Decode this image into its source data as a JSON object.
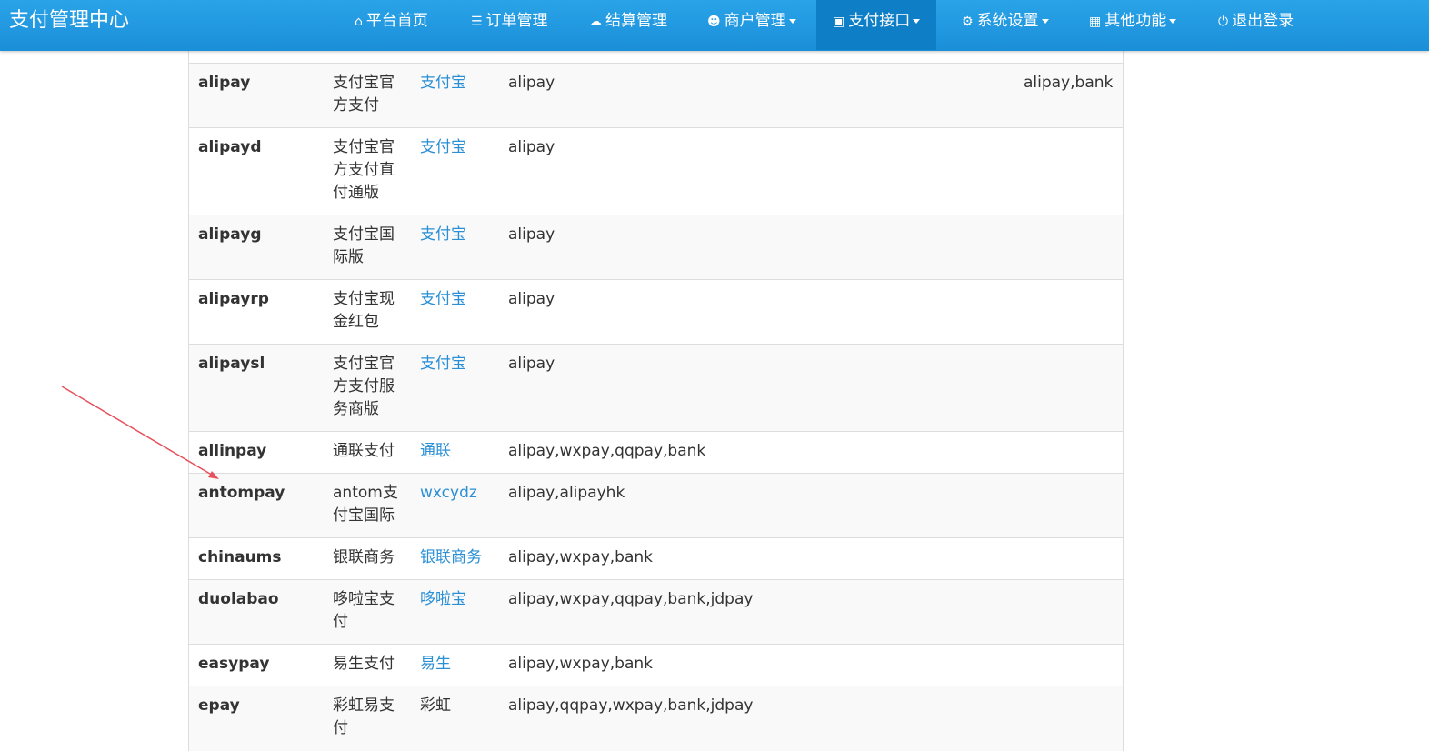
{
  "header": {
    "brand": "支付管理中心",
    "nav": [
      {
        "label": "平台首页",
        "icon": "home-icon",
        "dropdown": false,
        "active": false
      },
      {
        "label": "订单管理",
        "icon": "list-icon",
        "dropdown": false,
        "active": false
      },
      {
        "label": "结算管理",
        "icon": "cloud-icon",
        "dropdown": false,
        "active": false
      },
      {
        "label": "商户管理",
        "icon": "user-icon",
        "dropdown": true,
        "active": false
      },
      {
        "label": "支付接口",
        "icon": "credit-card-icon",
        "dropdown": true,
        "active": true
      },
      {
        "label": "系统设置",
        "icon": "gear-icon",
        "dropdown": true,
        "active": false
      },
      {
        "label": "其他功能",
        "icon": "cube-icon",
        "dropdown": true,
        "active": false
      },
      {
        "label": "退出登录",
        "icon": "power-icon",
        "dropdown": false,
        "active": false
      }
    ]
  },
  "table": {
    "rows": [
      {
        "code": "alipay",
        "name": "支付宝官方支付",
        "author": "支付宝",
        "author_link": true,
        "types": "alipay",
        "extra": "alipay,bank"
      },
      {
        "code": "alipayd",
        "name": "支付宝官方支付直付通版",
        "author": "支付宝",
        "author_link": true,
        "types": "alipay",
        "extra": ""
      },
      {
        "code": "alipayg",
        "name": "支付宝国际版",
        "author": "支付宝",
        "author_link": true,
        "types": "alipay",
        "extra": ""
      },
      {
        "code": "alipayrp",
        "name": "支付宝现金红包",
        "author": "支付宝",
        "author_link": true,
        "types": "alipay",
        "extra": ""
      },
      {
        "code": "alipaysl",
        "name": "支付宝官方支付服务商版",
        "author": "支付宝",
        "author_link": true,
        "types": "alipay",
        "extra": ""
      },
      {
        "code": "allinpay",
        "name": "通联支付",
        "author": "通联",
        "author_link": true,
        "types": "alipay,wxpay,qqpay,bank",
        "extra": ""
      },
      {
        "code": "antompay",
        "name": "antom支付宝国际",
        "author": "wxcydz",
        "author_link": true,
        "types": "alipay,alipayhk",
        "extra": ""
      },
      {
        "code": "chinaums",
        "name": "银联商务",
        "author": "银联商务",
        "author_link": true,
        "types": "alipay,wxpay,bank",
        "extra": ""
      },
      {
        "code": "duolabao",
        "name": "哆啦宝支付",
        "author": "哆啦宝",
        "author_link": true,
        "types": "alipay,wxpay,qqpay,bank,jdpay",
        "extra": ""
      },
      {
        "code": "easypay",
        "name": "易生支付",
        "author": "易生",
        "author_link": true,
        "types": "alipay,wxpay,bank",
        "extra": ""
      },
      {
        "code": "epay",
        "name": "彩虹易支付",
        "author": "彩虹",
        "author_link": false,
        "types": "alipay,qqpay,wxpay,bank,jdpay",
        "extra": ""
      }
    ]
  },
  "annotation": {
    "arrow_color": "#e8505b"
  },
  "colors": {
    "navbar": "#1f98e0",
    "nav_active": "#0e7fc7",
    "link": "#2a8fd5"
  }
}
